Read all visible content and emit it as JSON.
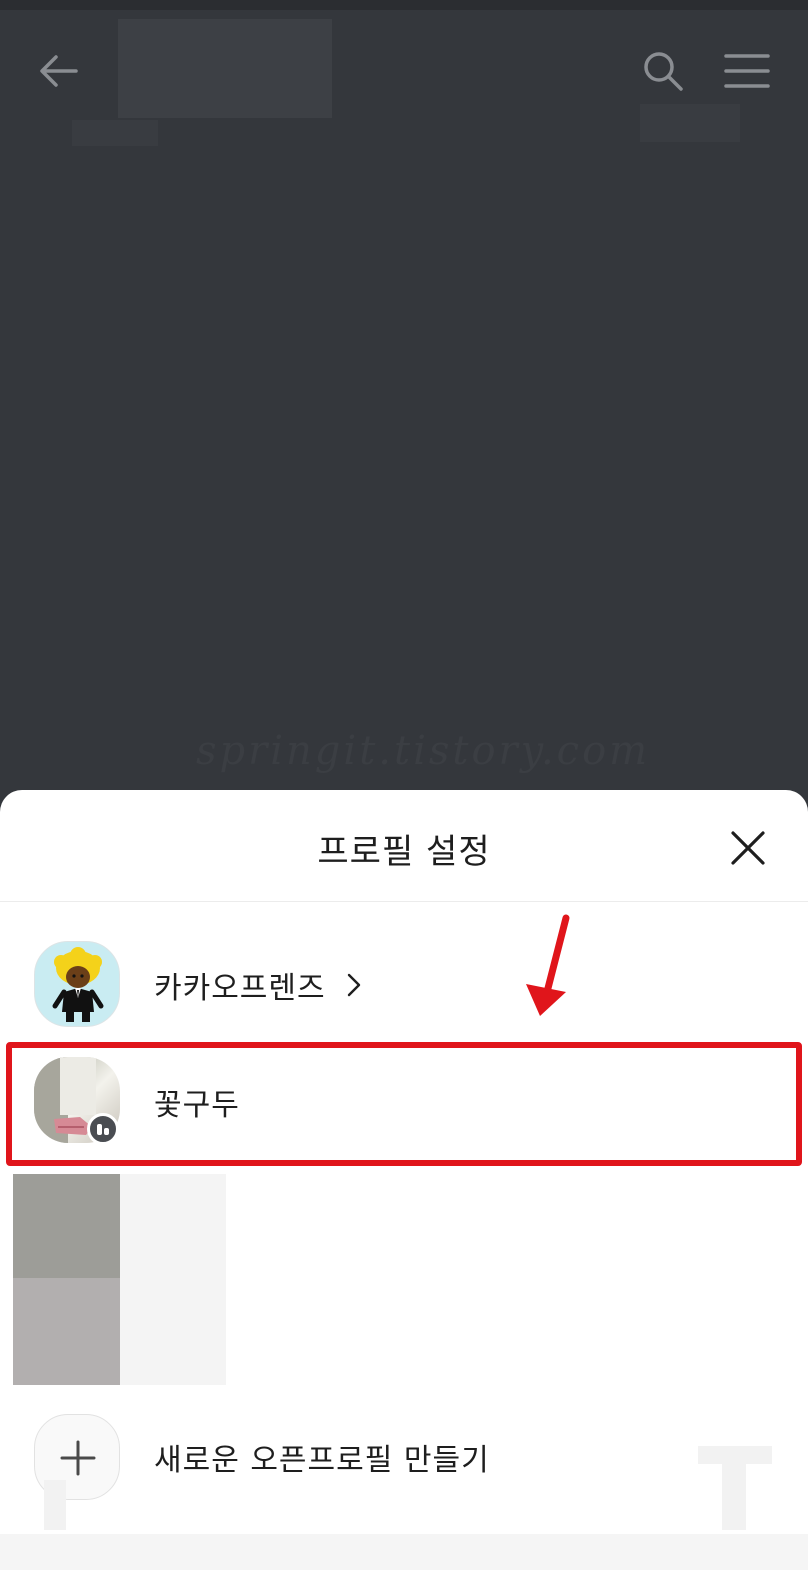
{
  "screen": {
    "background_color": "#34373c",
    "watermark": "springit.tistory.com"
  },
  "topbar": {
    "back_icon": "arrow-left-icon",
    "search_icon": "search-icon",
    "menu_icon": "hamburger-menu-icon"
  },
  "sheet": {
    "title": "프로필 설정",
    "close_icon": "close-icon",
    "profiles": [
      {
        "name": "카카오프렌즈",
        "has_chevron": true,
        "avatar": "kakao-friends-character"
      },
      {
        "name": "꽃구두",
        "has_badge": true,
        "avatar": "shoe-photo",
        "highlighted": true
      }
    ],
    "new_profile_label": "새로운 오픈프로필 만들기"
  },
  "annotation": {
    "highlight_color": "#e0151b",
    "arrow_color": "#e0151b"
  }
}
